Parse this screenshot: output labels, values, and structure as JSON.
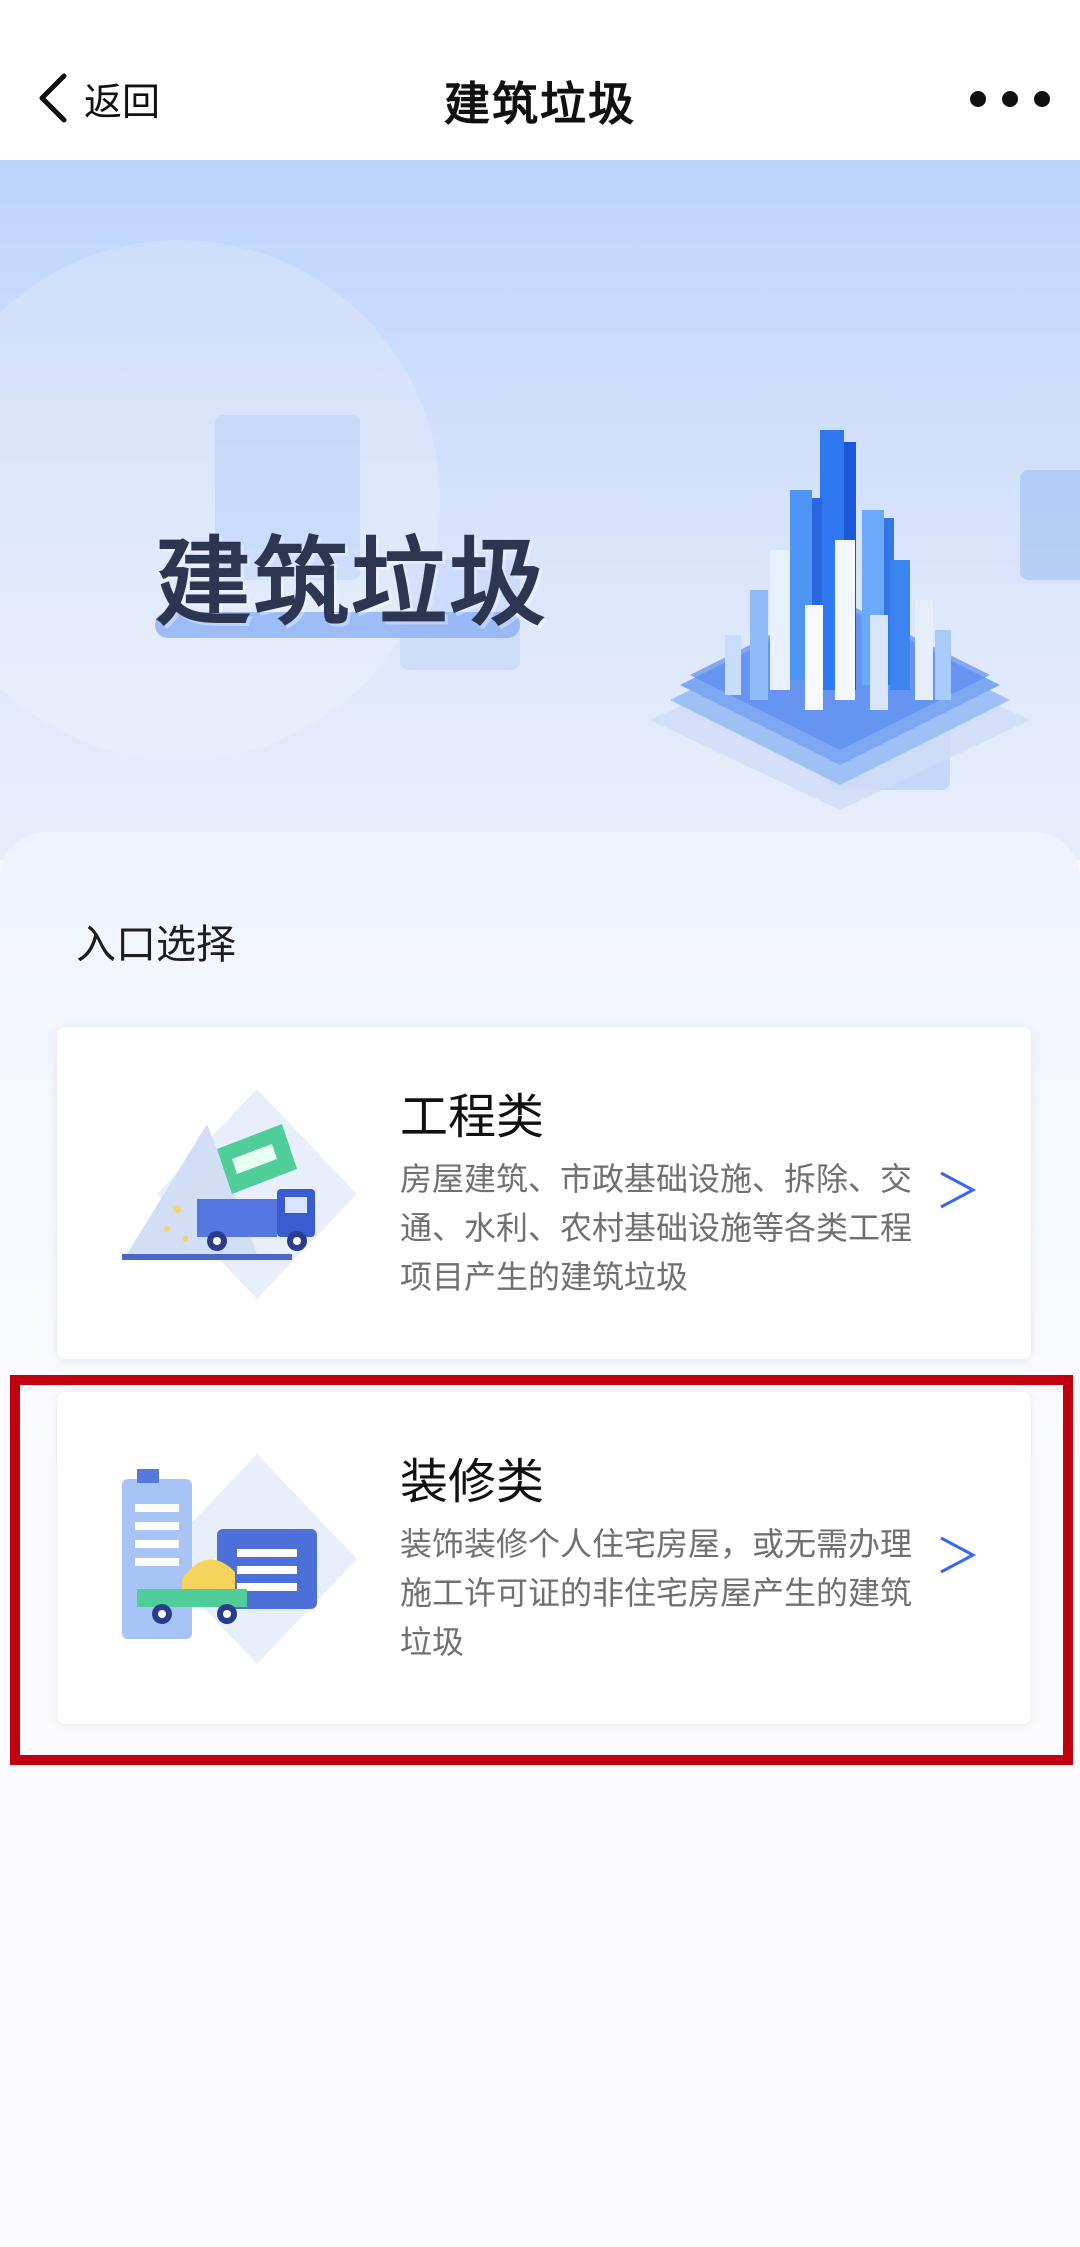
{
  "header": {
    "back_label": "返回",
    "title": "建筑垃圾"
  },
  "banner": {
    "title": "建筑垃圾"
  },
  "section": {
    "title": "入口选择"
  },
  "cards": [
    {
      "title": "工程类",
      "desc": "房屋建筑、市政基础设施、拆除、交通、水利、农村基础设施等各类工程项目产生的建筑垃圾"
    },
    {
      "title": "装修类",
      "desc": "装饰装修个人住宅房屋，或无需办理施工许可证的非住宅房屋产生的建筑垃圾"
    }
  ],
  "colors": {
    "accent": "#3a66f0",
    "highlight": "#c00010",
    "banner_top": "#bcd4fb"
  },
  "icons": {
    "back": "chevron-left-icon",
    "more": "more-dots-icon",
    "arrow": "chevron-right-icon"
  }
}
